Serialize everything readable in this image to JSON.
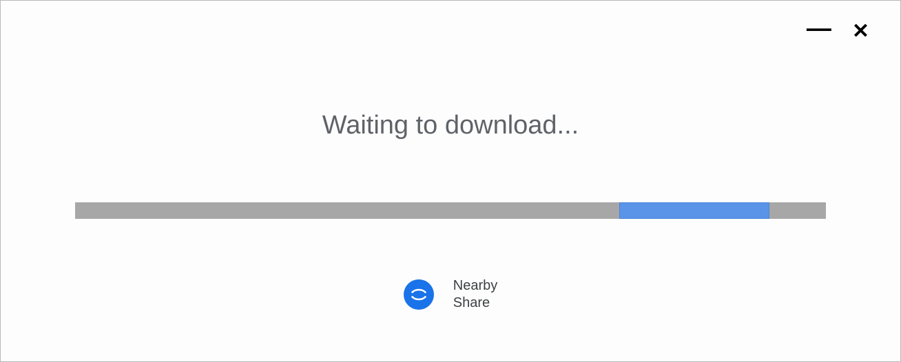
{
  "titlebar": {
    "minimize_glyph": "—",
    "close_glyph": "✕"
  },
  "main": {
    "status_text": "Waiting to download...",
    "progress": {
      "indicator_left_percent": 72.5,
      "indicator_width_percent": 20,
      "track_color": "#a7a7a7",
      "indicator_color": "#5a94e8"
    }
  },
  "footer": {
    "nearby_line1": "Nearby",
    "nearby_line2": "Share",
    "icon_bg": "#1a73e8"
  }
}
